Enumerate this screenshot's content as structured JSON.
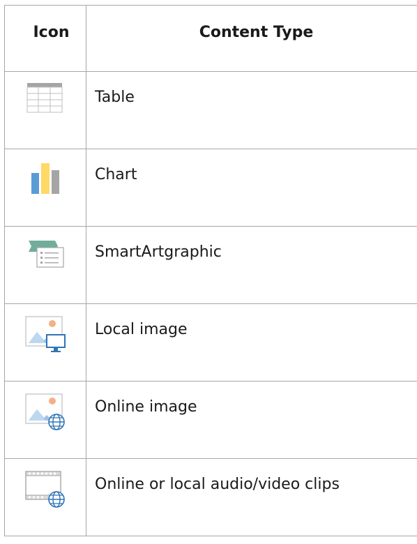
{
  "table": {
    "headers": {
      "icon": "Icon",
      "content_type": "Content Type"
    },
    "rows": [
      {
        "icon": "table-icon",
        "label": "Table"
      },
      {
        "icon": "chart-icon",
        "label": "Chart"
      },
      {
        "icon": "smartart-icon",
        "label": "SmartArtgraphic"
      },
      {
        "icon": "local-image-icon",
        "label": "Local image"
      },
      {
        "icon": "online-image-icon",
        "label": "Online image"
      },
      {
        "icon": "audio-video-clip-icon",
        "label": "Online or local audio/video clips"
      }
    ]
  },
  "colors": {
    "border": "#a6a6a6",
    "chart_blue": "#5b9bd5",
    "chart_yellow": "#ffd966",
    "chart_gray": "#a5a5a5",
    "smartart_green": "#70ad9b",
    "icon_blue": "#2e75b6",
    "sun_orange": "#f4b183"
  }
}
